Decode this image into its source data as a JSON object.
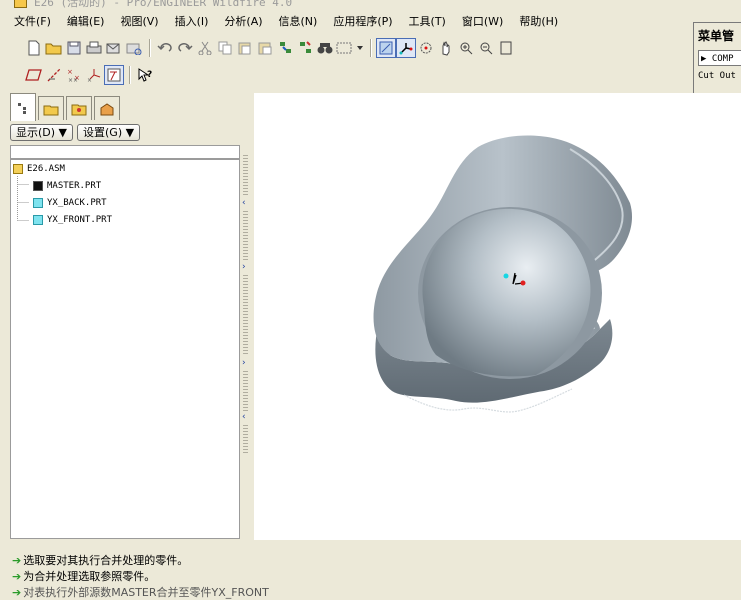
{
  "window": {
    "title_partial": "E26 (活动的) - Pro/ENGINEER Wildfire 4.0"
  },
  "menubar": [
    "文件(F)",
    "编辑(E)",
    "视图(V)",
    "插入(I)",
    "分析(A)",
    "信息(N)",
    "应用程序(P)",
    "工具(T)",
    "窗口(W)",
    "帮助(H)"
  ],
  "menu_manager": {
    "title": "菜单管",
    "item_selected": "▶ COMP",
    "item_2": "Cut Out"
  },
  "left_panel": {
    "tabs": [
      "model-tree-tab",
      "layer-tree-tab",
      "favorites-tab",
      "connections-tab"
    ],
    "show_button": "显示(D) ▼",
    "settings_button": "设置(G) ▼",
    "tree": [
      {
        "label": "E26.ASM",
        "icon": "assembly-icon"
      },
      {
        "label": "MASTER.PRT",
        "icon": "part-dark-icon"
      },
      {
        "label": "YX_BACK.PRT",
        "icon": "part-icon"
      },
      {
        "label": "YX_FRONT.PRT",
        "icon": "part-icon"
      }
    ]
  },
  "messages": [
    "选取要对其执行合并处理的零件。",
    "为合并处理选取参照零件。",
    "对表执行外部源数MASTER合并至零件YX_FRONT"
  ],
  "colors": {
    "message_arrow": "#2a9b2a",
    "model_surface": "#9aa7b0",
    "graphics_bg": "#ffffff"
  }
}
